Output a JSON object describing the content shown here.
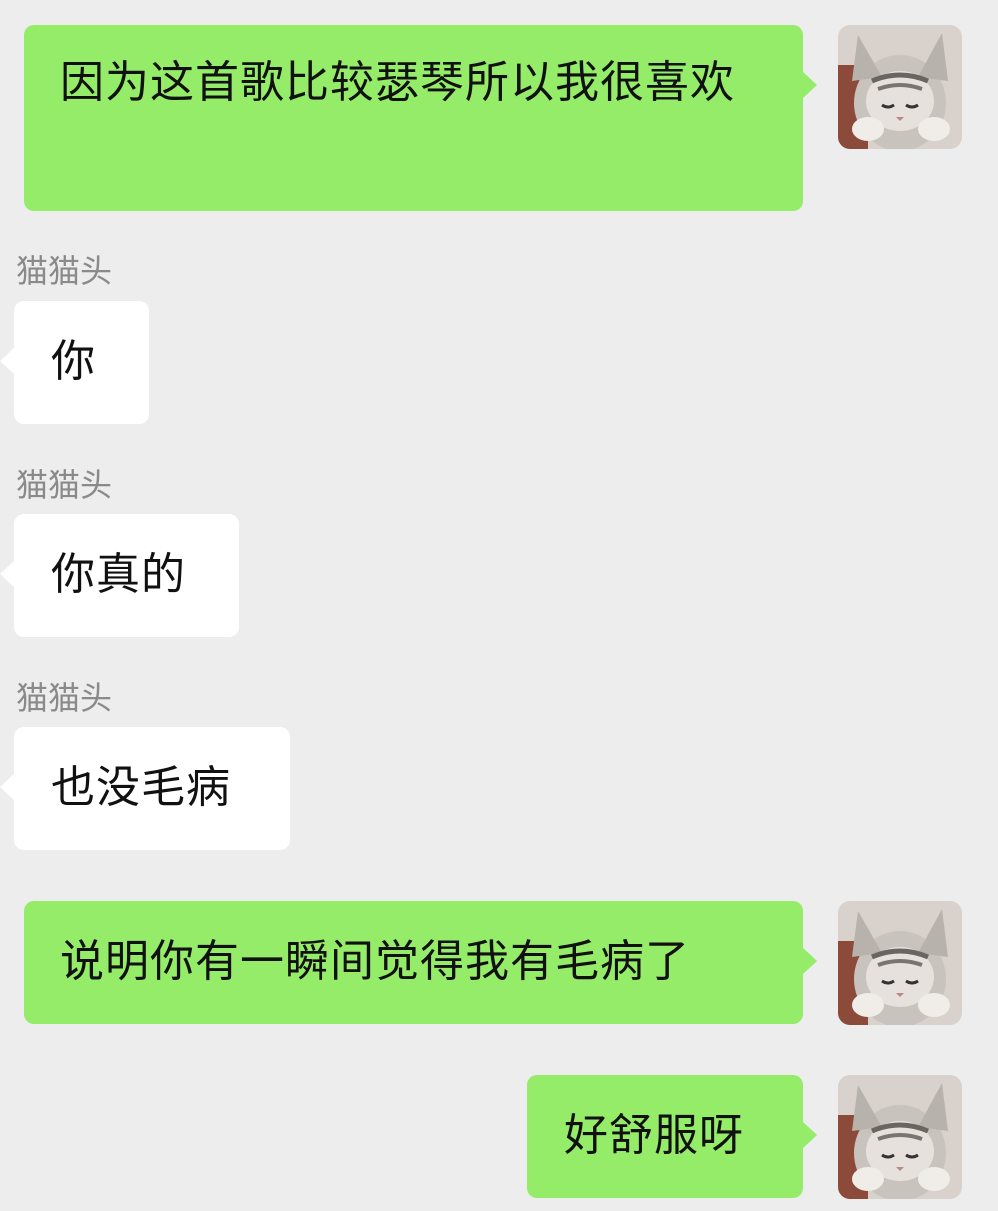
{
  "messages": [
    {
      "direction": "out",
      "text": "因为这首歌比较瑟琴所以我很喜欢"
    },
    {
      "direction": "in",
      "sender": "猫猫头",
      "text": "你"
    },
    {
      "direction": "in",
      "sender": "猫猫头",
      "text": "你真的"
    },
    {
      "direction": "in",
      "sender": "猫猫头",
      "text": "也没毛病"
    },
    {
      "direction": "out",
      "text": "说明你有一瞬间觉得我有毛病了"
    },
    {
      "direction": "out",
      "text": "好舒服呀"
    }
  ],
  "avatar_icon": "cat-avatar-icon",
  "colors": {
    "background": "#ededed",
    "outgoing_bubble": "#95ec69",
    "incoming_bubble": "#ffffff",
    "sender_name": "#8a8a8a"
  }
}
